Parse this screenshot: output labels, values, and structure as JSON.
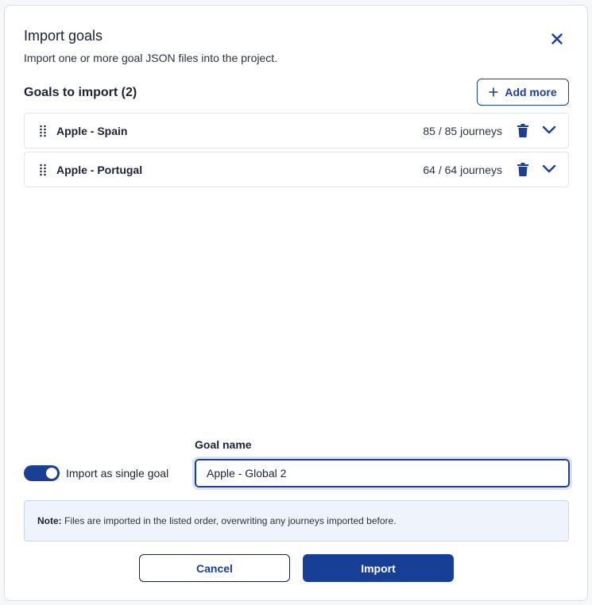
{
  "dialog": {
    "title": "Import goals",
    "subtitle": "Import one or more goal JSON files into the project.",
    "close_icon": "close-icon"
  },
  "goals_section": {
    "title": "Goals to import (2)",
    "add_more_label": "Add more",
    "items": [
      {
        "name": "Apple - Spain",
        "count": "85 / 85 journeys"
      },
      {
        "name": "Apple - Portugal",
        "count": "64 / 64 journeys"
      }
    ]
  },
  "options": {
    "single_goal_label": "Import as single goal",
    "single_goal_on": true,
    "goal_name_label": "Goal name",
    "goal_name_value": "Apple - Global 2"
  },
  "note": {
    "prefix": "Note:",
    "text": " Files are imported in the listed order, overwriting any journeys imported before."
  },
  "actions": {
    "cancel_label": "Cancel",
    "import_label": "Import"
  },
  "colors": {
    "accent": "#1a3f94",
    "note_bg": "#eef3fc"
  }
}
